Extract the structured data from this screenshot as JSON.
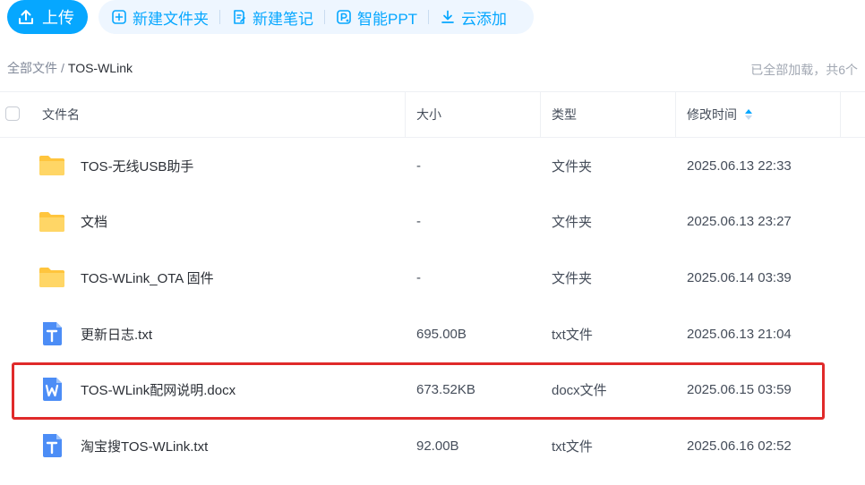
{
  "toolbar": {
    "upload_label": "上传",
    "actions": [
      {
        "label": "新建文件夹",
        "icon": "add-folder-icon"
      },
      {
        "label": "新建笔记",
        "icon": "note-icon"
      },
      {
        "label": "智能PPT",
        "icon": "ppt-icon"
      },
      {
        "label": "云添加",
        "icon": "download-icon"
      }
    ]
  },
  "breadcrumb": {
    "root": "全部文件",
    "separator": "/",
    "current": "TOS-WLink"
  },
  "status": {
    "loaded_text": "已全部加载，共6个"
  },
  "table": {
    "headers": {
      "name": "文件名",
      "size": "大小",
      "type": "类型",
      "modified": "修改时间"
    },
    "rows": [
      {
        "name": "TOS-无线USB助手",
        "size": "-",
        "type": "文件夹",
        "modified": "2025.06.13 22:33",
        "icon": "folder-icon"
      },
      {
        "name": "文档",
        "size": "-",
        "type": "文件夹",
        "modified": "2025.06.13 23:27",
        "icon": "folder-icon"
      },
      {
        "name": "TOS-WLink_OTA 固件",
        "size": "-",
        "type": "文件夹",
        "modified": "2025.06.14 03:39",
        "icon": "folder-icon"
      },
      {
        "name": "更新日志.txt",
        "size": "695.00B",
        "type": "txt文件",
        "modified": "2025.06.13 21:04",
        "icon": "txt-file-icon"
      },
      {
        "name": "TOS-WLink配网说明.docx",
        "size": "673.52KB",
        "type": "docx文件",
        "modified": "2025.06.15 03:59",
        "icon": "word-file-icon"
      },
      {
        "name": "淘宝搜TOS-WLink.txt",
        "size": "92.00B",
        "type": "txt文件",
        "modified": "2025.06.16 02:52",
        "icon": "txt-file-icon"
      }
    ]
  },
  "colors": {
    "accent": "#06a7ff",
    "highlight": "#e02a2a",
    "folder": "#ffc53d",
    "file_blue": "#4c8df6"
  }
}
